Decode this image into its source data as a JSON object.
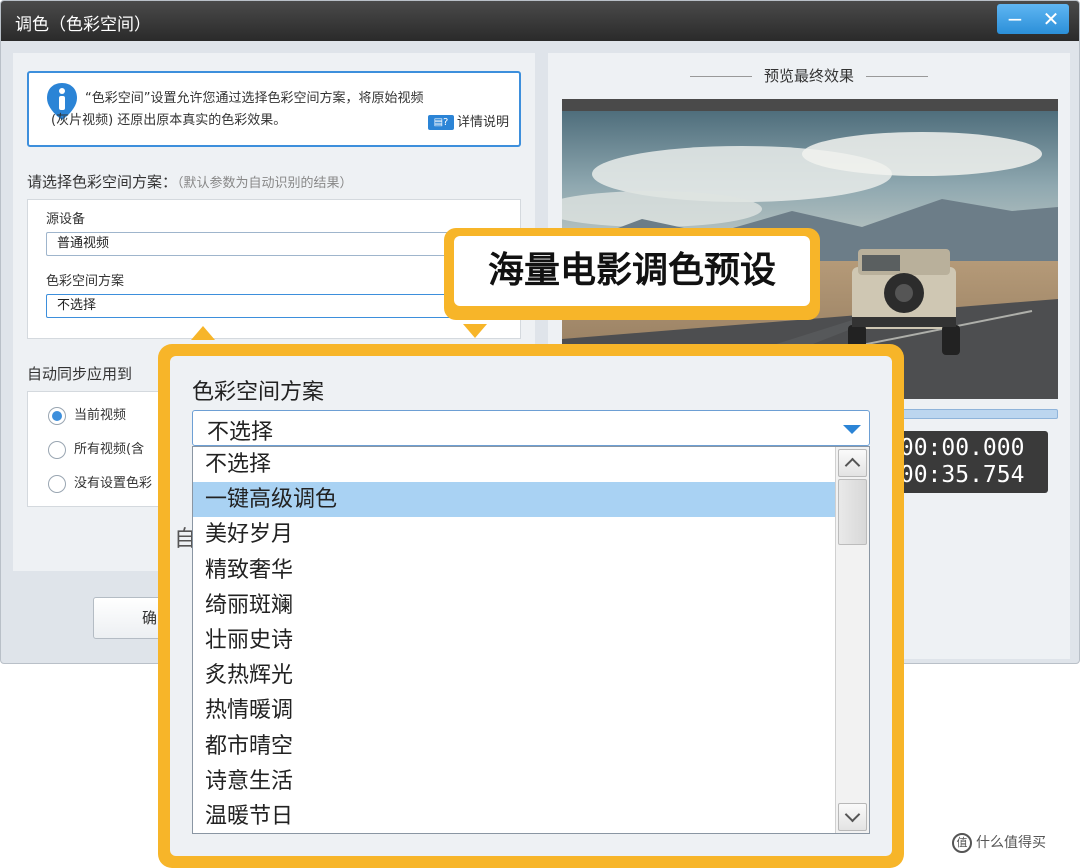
{
  "window": {
    "title": "调色（色彩空间）",
    "minimize_label": "−",
    "close_label": "✕"
  },
  "info": {
    "icon": "info-icon",
    "line1": "“色彩空间”设置允许您通过选择色彩空间方案，将原始视频",
    "line2": "(灰片视频) 还原出原本真实的色彩效果。",
    "detail_link": "详情说明"
  },
  "scheme": {
    "title": "请选择色彩空间方案：",
    "hint": "（默认参数为自动识别的结果）",
    "source_label": "源设备",
    "source_value": "普通视频",
    "color_label": "色彩空间方案",
    "color_value": "不选择"
  },
  "sync": {
    "title": "自动同步应用到",
    "options": [
      {
        "label": "当前视频",
        "checked": true
      },
      {
        "label": "所有视频(含",
        "checked": false
      },
      {
        "label": "没有设置色彩",
        "checked": false
      }
    ]
  },
  "ok_button": "确",
  "preview": {
    "title": "预览最终效果",
    "time_current": ":00:00.000",
    "time_total": ":00:35.754"
  },
  "callout": {
    "text": "海量电影调色预设"
  },
  "zoom": {
    "label": "色彩空间方案",
    "selected_value": "不选择",
    "peek_text": "自",
    "items": [
      "不选择",
      "一键高级调色",
      "美好岁月",
      "精致奢华",
      "绮丽斑斓",
      "壮丽史诗",
      "炙热辉光",
      "热情暖调",
      "都市晴空",
      "诗意生活",
      "温暖节日"
    ],
    "highlighted_index": 1
  },
  "watermark": {
    "icon_text": "值",
    "text": "什么值得买"
  },
  "colors": {
    "accent": "#3d8fdc",
    "callout": "#f7b529",
    "selection": "#a9d2f3"
  }
}
